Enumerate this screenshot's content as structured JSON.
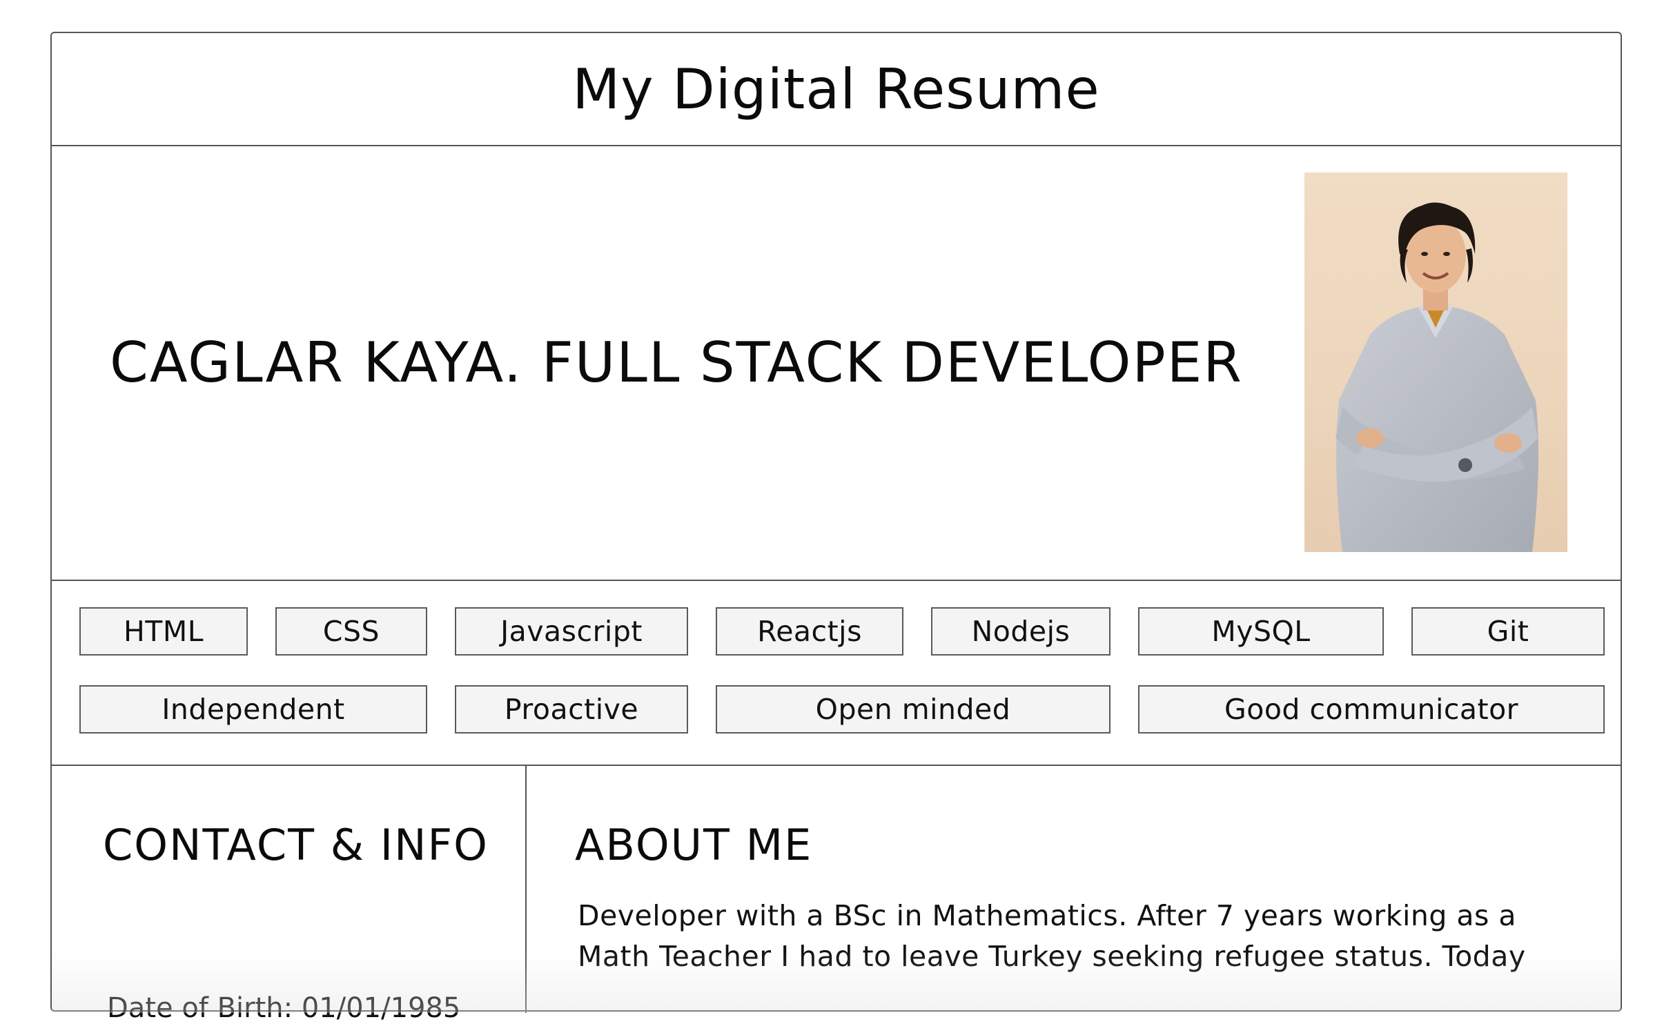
{
  "header": {
    "title": "My Digital Resume"
  },
  "hero": {
    "name_title": "CAGLAR KAYA. FULL STACK DEVELOPER",
    "photo_alt": "Portrait of Caglar Kaya"
  },
  "skills": {
    "technical": [
      "HTML",
      "CSS",
      "Javascript",
      "Reactjs",
      "Nodejs",
      "MySQL",
      "Git"
    ],
    "soft": [
      "Independent",
      "Proactive",
      "Open minded",
      "Good communicator"
    ]
  },
  "contact": {
    "heading": "CONTACT & INFO",
    "date_of_birth": "Date of Birth: 01/01/1985"
  },
  "about": {
    "heading": "ABOUT ME",
    "text": "Developer with a BSc in Mathematics. After 7 years working as a Math Teacher I had to leave Turkey seeking refugee status. Today"
  }
}
